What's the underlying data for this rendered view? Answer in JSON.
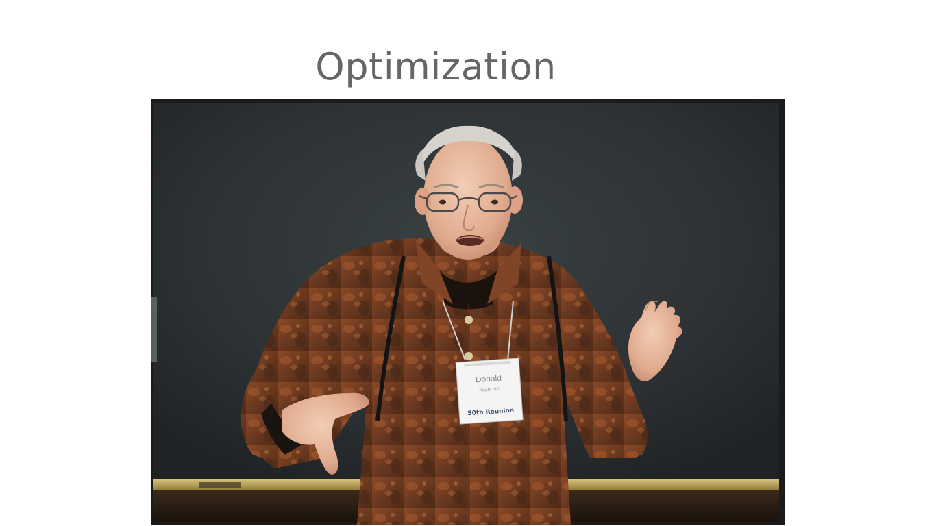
{
  "slide": {
    "title": "Optimization"
  },
  "photo": {
    "subject": "man-gesturing-at-chalkboard",
    "badge": {
      "line1": "Donald",
      "line2": "Knuth '60",
      "footer": "50th Reunion"
    }
  },
  "colors": {
    "title_text": "#666666",
    "chalkboard": "#2e3335",
    "frame": "#1b1b1b",
    "chalk_tray": "#c2a85a",
    "shirt": "#7a3f22"
  }
}
